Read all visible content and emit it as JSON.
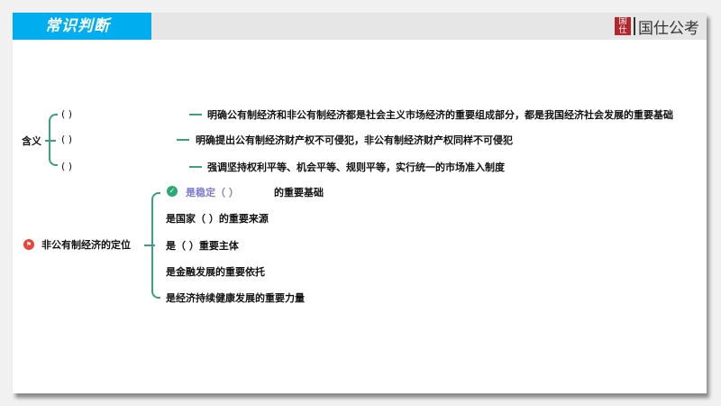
{
  "header": {
    "title": "常识判断",
    "logo_text": "国仕公考",
    "logo_seal": "国仕"
  },
  "meaning": {
    "label": "含义",
    "items": [
      {
        "blank": "(                )",
        "text": "明确公有制经济和非公有制经济都是社会主义市场经济的重要组成部分，都是我国经济社会发展的重要基础"
      },
      {
        "blank": "(                )",
        "text": "明确提出公有制经济财产权不可侵犯，非公有制经济财产权同样不可侵犯"
      },
      {
        "blank": "(                )",
        "text": "强调坚持权利平等、机会平等、规则平等，实行统一的市场准入制度"
      }
    ]
  },
  "position": {
    "label": "非公有制经济的定位",
    "items": [
      {
        "pre": "是稳定（            ）",
        "post": "的重要基础"
      },
      {
        "pre": "是国家（         ）的重要来源",
        "post": ""
      },
      {
        "pre": "是（             ）重要主体",
        "post": ""
      },
      {
        "pre": "是金融发展的重要依托",
        "post": ""
      },
      {
        "pre": "是经济持续健康发展的重要力量",
        "post": ""
      }
    ]
  },
  "colors": {
    "accent": "#00aeef",
    "branch": "#3aa080",
    "check": "#2aa876",
    "flag": "#e8453c"
  }
}
